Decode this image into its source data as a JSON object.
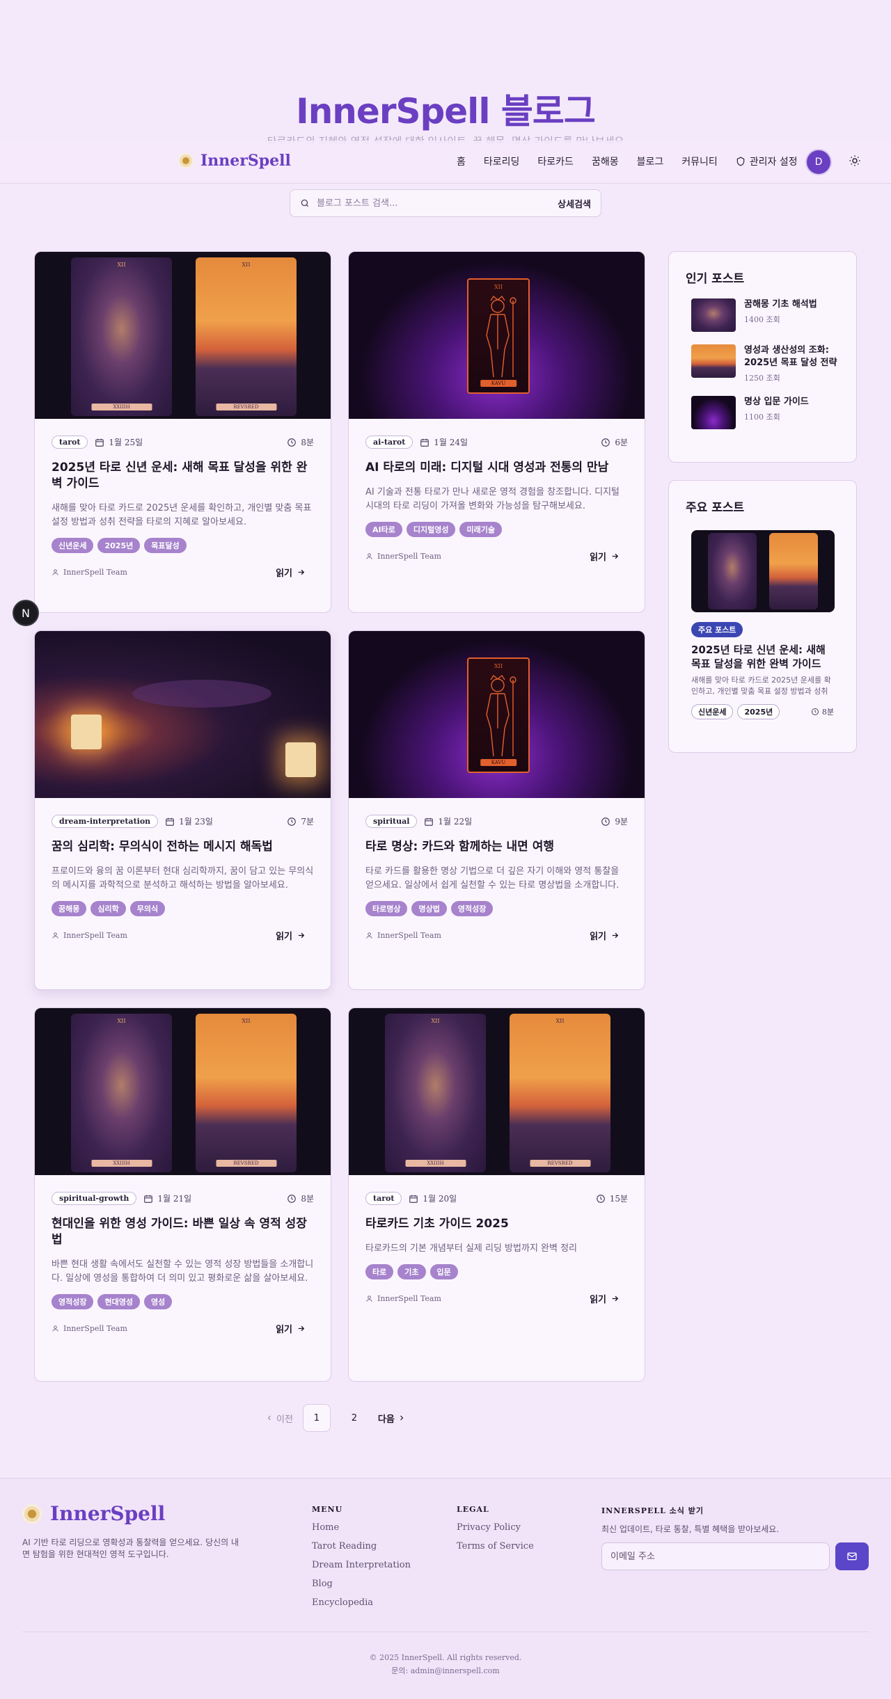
{
  "hero": {
    "title": "InnerSpell 블로그",
    "subtitle": "타로카드의 지혜와 영적 성장에 대한 인사이트, 꿈 해몽, 명상 가이드를 만나보세요"
  },
  "header": {
    "logo": "InnerSpell",
    "nav": [
      "홈",
      "타로리딩",
      "타로카드",
      "꿈해몽",
      "블로그",
      "커뮤니티"
    ],
    "admin": "관리자 설정",
    "avatar_initial": "D"
  },
  "search": {
    "placeholder": "블로그 포스트 검색...",
    "advanced": "상세검색"
  },
  "posts": [
    {
      "category": "tarot",
      "date": "1월 25일",
      "read_time": "8분",
      "title": "2025년 타로 신년 운세: 새해 목표 달성을 위한 완벽 가이드",
      "desc": "새해를 맞아 타로 카드로 2025년 운세를 확인하고, 개인별 맞춤 목표 설정 방법과 성취 전략을 타로의 지혜로 알아보세요.",
      "tags": [
        "신년운세",
        "2025년",
        "목표달성"
      ],
      "author": "InnerSpell Team",
      "read_more": "읽기"
    },
    {
      "category": "ai-tarot",
      "date": "1월 24일",
      "read_time": "6분",
      "title": "AI 타로의 미래: 디지털 시대 영성과 전통의 만남",
      "desc": "AI 기술과 전통 타로가 만나 새로운 영적 경험을 창조합니다. 디지털 시대의 타로 리딩이 가져올 변화와 가능성을 탐구해보세요.",
      "tags": [
        "AI타로",
        "디지털영성",
        "미래기술"
      ],
      "author": "InnerSpell Team",
      "read_more": "읽기"
    },
    {
      "category": "dream-interpretation",
      "date": "1월 23일",
      "read_time": "7분",
      "title": "꿈의 심리학: 무의식이 전하는 메시지 해독법",
      "desc": "프로이드와 융의 꿈 이론부터 현대 심리학까지, 꿈이 담고 있는 무의식의 메시지를 과학적으로 분석하고 해석하는 방법을 알아보세요.",
      "tags": [
        "꿈해몽",
        "심리학",
        "무의식"
      ],
      "author": "InnerSpell Team",
      "read_more": "읽기"
    },
    {
      "category": "spiritual",
      "date": "1월 22일",
      "read_time": "9분",
      "title": "타로 명상: 카드와 함께하는 내면 여행",
      "desc": "타로 카드를 활용한 명상 기법으로 더 깊은 자기 이해와 영적 통찰을 얻으세요. 일상에서 쉽게 실천할 수 있는 타로 명상법을 소개합니다.",
      "tags": [
        "타로명상",
        "명상법",
        "영적성장"
      ],
      "author": "InnerSpell Team",
      "read_more": "읽기"
    },
    {
      "category": "spiritual-growth",
      "date": "1월 21일",
      "read_time": "8분",
      "title": "현대인을 위한 영성 가이드: 바쁜 일상 속 영적 성장법",
      "desc": "바쁜 현대 생활 속에서도 실천할 수 있는 영적 성장 방법들을 소개합니다. 일상에 영성을 통합하여 더 의미 있고 평화로운 삶을 살아보세요.",
      "tags": [
        "영적성장",
        "현대영성",
        "영성"
      ],
      "author": "InnerSpell Team",
      "read_more": "읽기"
    },
    {
      "category": "tarot",
      "date": "1월 20일",
      "read_time": "15분",
      "title": "타로카드 기초 가이드 2025",
      "desc": "타로카드의 기본 개념부터 실제 리딩 방법까지 완벽 정리",
      "tags": [
        "타로",
        "기초",
        "입문"
      ],
      "author": "InnerSpell Team",
      "read_more": "읽기"
    }
  ],
  "card_art": {
    "left_num": "XII",
    "left_label": "XXIIIH",
    "right_num": "XII",
    "right_label": "REVSRED",
    "emperor_num": "XII",
    "emperor_label": "KAVU"
  },
  "popular": {
    "title": "인기 포스트",
    "items": [
      {
        "title": "꿈해몽 기초 해석법",
        "views": "1400 조회"
      },
      {
        "title": "영성과 생산성의 조화: 2025년 목표 달성 전략",
        "views": "1250 조회"
      },
      {
        "title": "명상 입문 가이드",
        "views": "1100 조회"
      }
    ]
  },
  "featured": {
    "title": "주요 포스트",
    "badge": "주요 포스트",
    "post_title": "2025년 타로 신년 운세: 새해 목표 달성을 위한 완벽 가이드",
    "desc": "새해를 맞아 타로 카드로 2025년 운세를 확인하고, 개인별 맞춤 목표 설정 방법과 성취 전략을 타로의 지혜로 알아보세요.",
    "tags": [
      "신년운세",
      "2025년"
    ],
    "read_time": "8분"
  },
  "pagination": {
    "prev": "이전",
    "pages": [
      "1",
      "2"
    ],
    "next": "다음"
  },
  "footer": {
    "logo": "InnerSpell",
    "about": "AI 기반 타로 리딩으로 영확성과 통찰력을 얻으세요. 당신의 내면 탐험을 위한 현대적인 영적 도구입니다.",
    "menu_head": "MENU",
    "menu": [
      "Home",
      "Tarot Reading",
      "Dream Interpretation",
      "Blog",
      "Encyclopedia"
    ],
    "legal_head": "LEGAL",
    "legal": [
      "Privacy Policy",
      "Terms of Service"
    ],
    "news_head": "INNERSPELL 소식 받기",
    "news_sub": "최신 업데이트, 타로 통찰, 특별 혜택을 받아보세요.",
    "email_placeholder": "이메일 주소",
    "copyright": "© 2025 InnerSpell. All rights reserved.",
    "contact": "문의: admin@innerspell.com"
  },
  "dev_badge": "N"
}
